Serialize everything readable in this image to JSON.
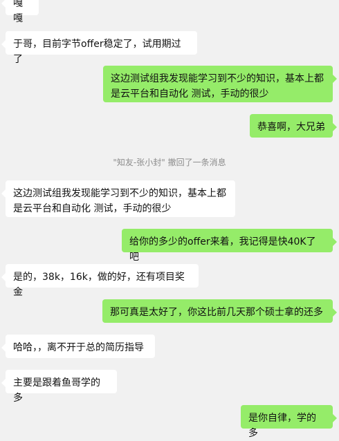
{
  "messages": [
    {
      "side": "in",
      "text": "嘎嘎"
    },
    {
      "side": "in",
      "text": "于哥，目前字节offer稳定了，试用期过了"
    },
    {
      "side": "out",
      "text": "这边测试组我发现能学习到不少的知识，基本上都\n是云平台和自动化 测试，手动的很少"
    },
    {
      "side": "out",
      "text": "恭喜啊，大兄弟"
    },
    {
      "side": "system",
      "text": "\"知友-张小封\" 撤回了一条消息"
    },
    {
      "side": "in",
      "text": "这边测试组我发现能学习到不少的知识，基本上都\n是云平台和自动化 测试，手动的很少"
    },
    {
      "side": "out",
      "text": "给你的多少的offer来着，我记得是快40K了吧"
    },
    {
      "side": "in",
      "text": "是的，38k，16k，做的好，还有项目奖金"
    },
    {
      "side": "out",
      "text": "那可真是太好了，你这比前几天那个硕士拿的还多"
    },
    {
      "side": "in",
      "text": "哈哈，，离不开于总的简历指导"
    },
    {
      "side": "in",
      "text": "主要是跟着鱼哥学的多"
    },
    {
      "side": "out",
      "text": "是你自律，学的多"
    }
  ]
}
